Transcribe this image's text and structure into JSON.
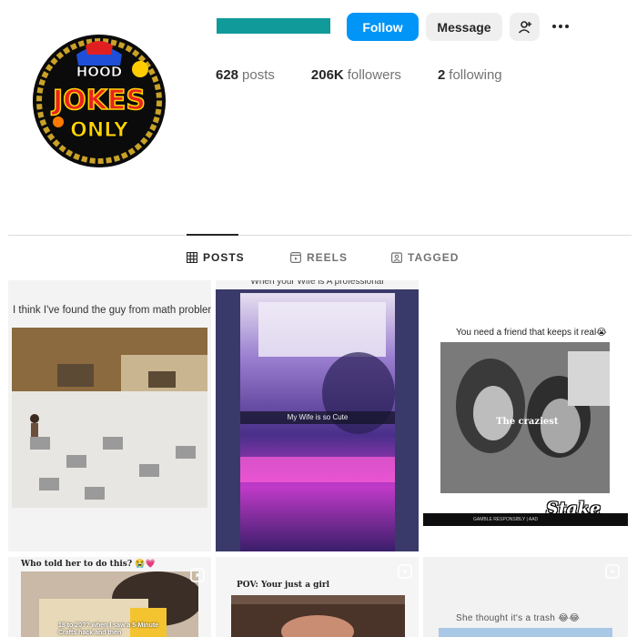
{
  "profile": {
    "avatar": {
      "words": [
        "HOOD",
        "JOKES",
        "ONLY"
      ]
    },
    "actions": {
      "follow_label": "Follow",
      "message_label": "Message"
    },
    "stats": [
      {
        "value": "628",
        "label": "posts"
      },
      {
        "value": "206K",
        "label": "followers"
      },
      {
        "value": "2",
        "label": "following"
      }
    ]
  },
  "tabs": [
    {
      "label": "POSTS",
      "icon": "grid-icon",
      "active": true
    },
    {
      "label": "REELS",
      "icon": "reels-icon",
      "active": false
    },
    {
      "label": "TAGGED",
      "icon": "tagged-icon",
      "active": false
    }
  ],
  "posts": [
    {
      "caption": "I think I've found the guy from math problems"
    },
    {
      "caption": "When your Wife is A professional",
      "overlay": "My Wife is so Cute"
    },
    {
      "caption": "You need a friend that keeps it real😭",
      "overlay": "The craziest",
      "brand": "Stake",
      "footer": "GAMBLE RESPONSIBLY | AAD"
    },
    {
      "caption": "Who told her to do this? 😭💗",
      "overlay": "18 to 20?? when I saw a 5-Minute Crafts hack and then"
    },
    {
      "caption": "POV: Your just a girl"
    },
    {
      "caption": "She thought it's a trash 😂😂"
    }
  ],
  "colors": {
    "follow": "#0095f6",
    "username_block": "#109a9a",
    "secondary_button": "#efefef"
  }
}
